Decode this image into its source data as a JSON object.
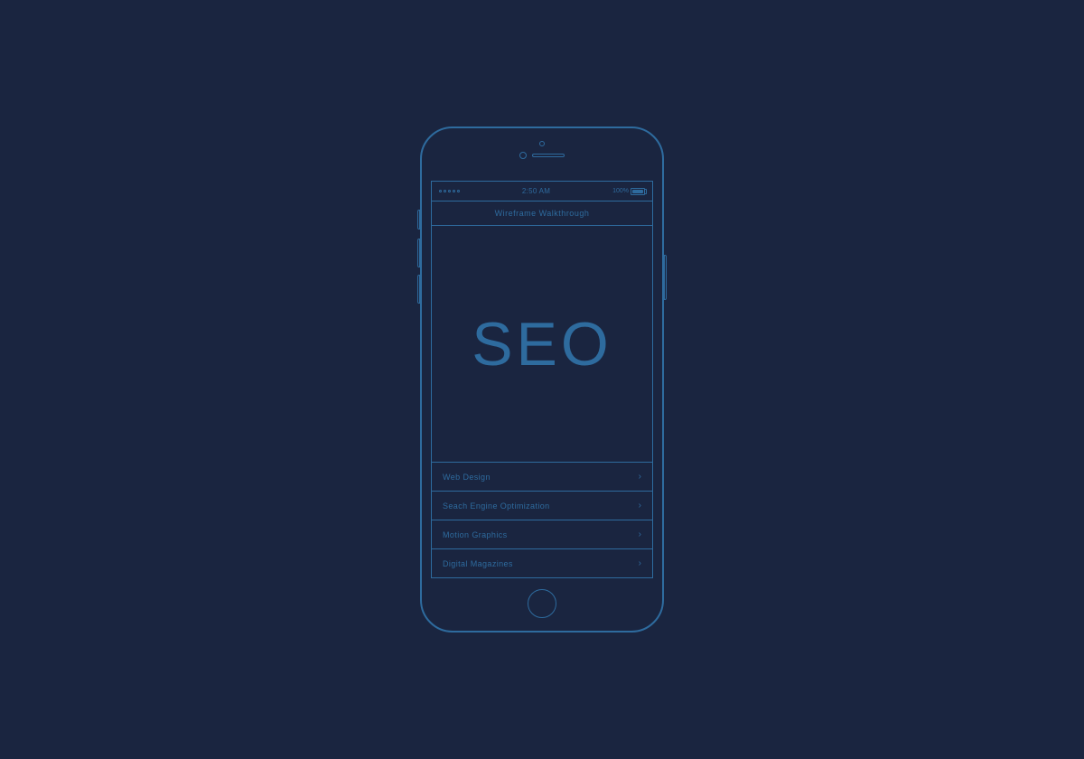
{
  "phone": {
    "status_bar": {
      "signal": ".....",
      "time": "2:50 AM",
      "battery_percent": "100%"
    },
    "nav": {
      "title": "Wireframe Walkthrough"
    },
    "hero": {
      "text": "SEO"
    },
    "menu": {
      "items": [
        {
          "label": "Web Design",
          "chevron": "›"
        },
        {
          "label": "Seach Engine Optimization",
          "chevron": "›"
        },
        {
          "label": "Motion Graphics",
          "chevron": "›"
        },
        {
          "label": "Digital Magazines",
          "chevron": "›"
        }
      ]
    }
  }
}
